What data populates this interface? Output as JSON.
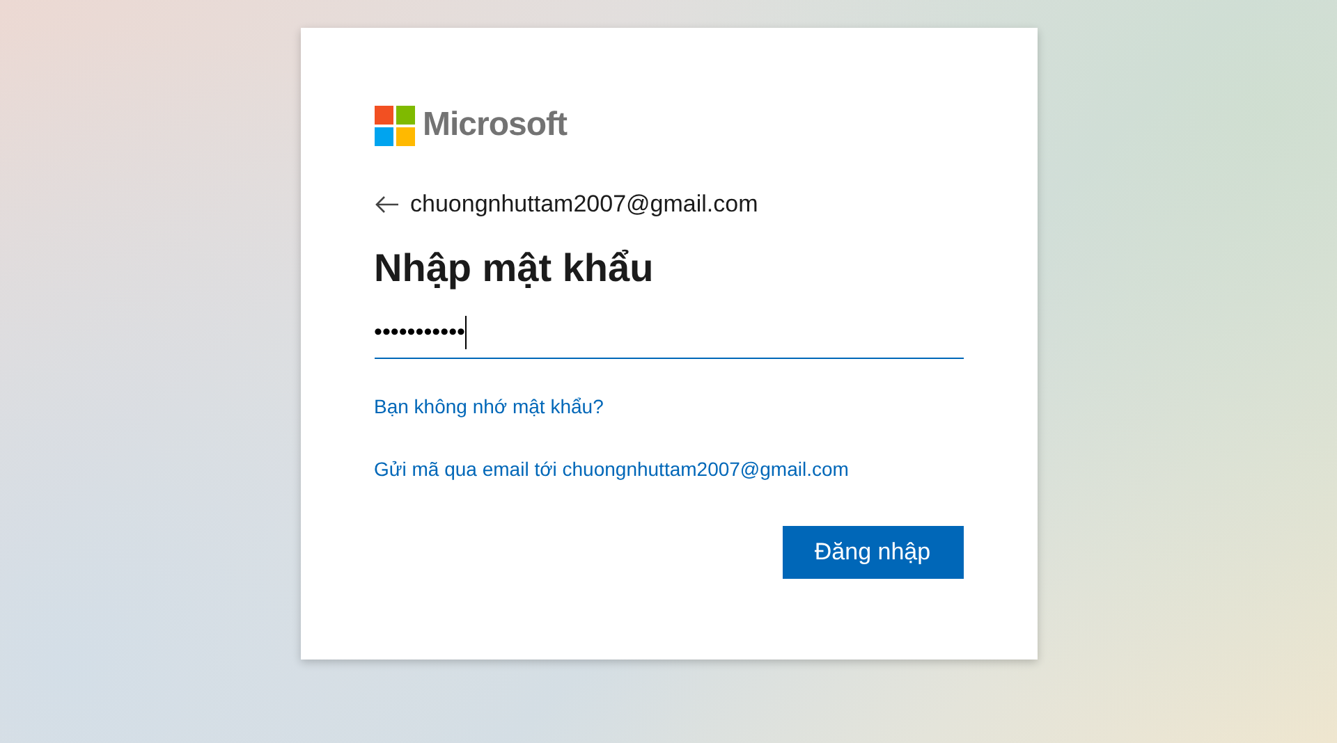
{
  "brand": {
    "name": "Microsoft"
  },
  "account": {
    "email": "chuongnhuttam2007@gmail.com"
  },
  "title": "Nhập mật khẩu",
  "password": {
    "value": "•••••••••••",
    "focused": true
  },
  "links": [
    "Bạn không nhớ mật khẩu?",
    "Gửi mã qua email tới chuongnhuttam2007@gmail.com"
  ],
  "buttons": [
    {
      "label": "Đăng nhập"
    }
  ]
}
